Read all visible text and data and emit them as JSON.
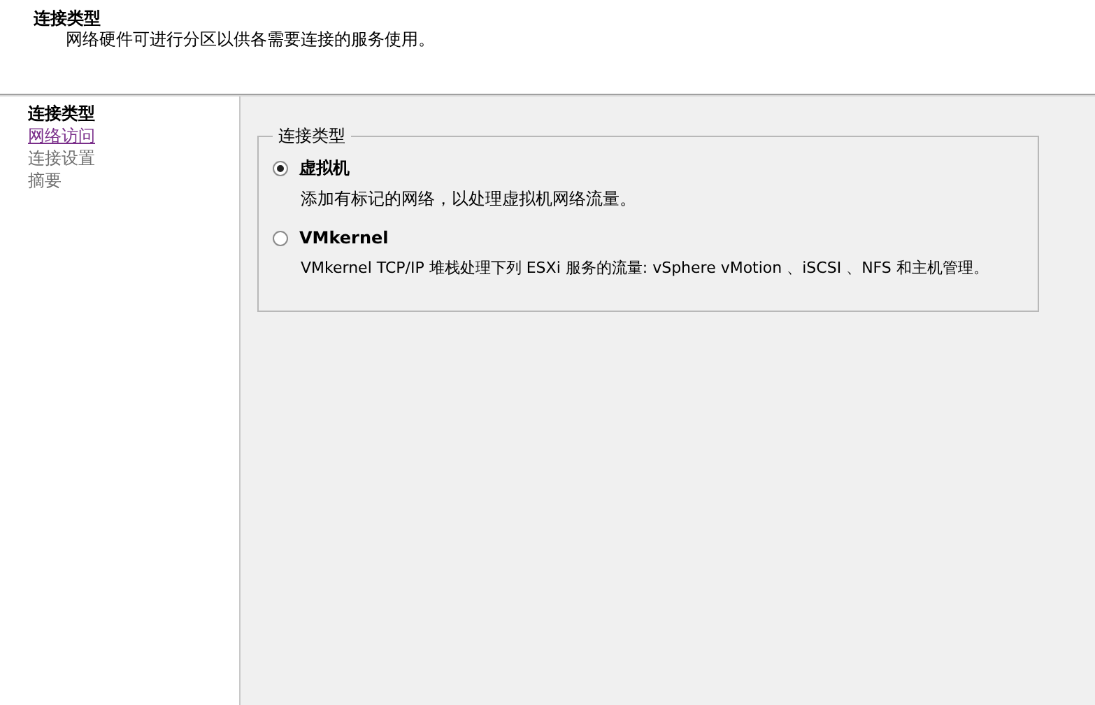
{
  "header": {
    "title": "连接类型",
    "subtitle": "网络硬件可进行分区以供各需要连接的服务使用。"
  },
  "steps": [
    {
      "label": "连接类型",
      "kind": "current"
    },
    {
      "label": "网络访问",
      "kind": "link"
    },
    {
      "label": "连接设置",
      "kind": "pending"
    },
    {
      "label": "摘要",
      "kind": "pending"
    }
  ],
  "group": {
    "legend": "连接类型",
    "options": [
      {
        "label": "虚拟机",
        "description": "添加有标记的网络，以处理虚拟机网络流量。",
        "selected": true
      },
      {
        "label": "VMkernel",
        "description": "VMkernel TCP/IP 堆栈处理下列 ESXi 服务的流量: vSphere vMotion 、iSCSI 、NFS 和主机管理。",
        "selected": false
      }
    ]
  }
}
